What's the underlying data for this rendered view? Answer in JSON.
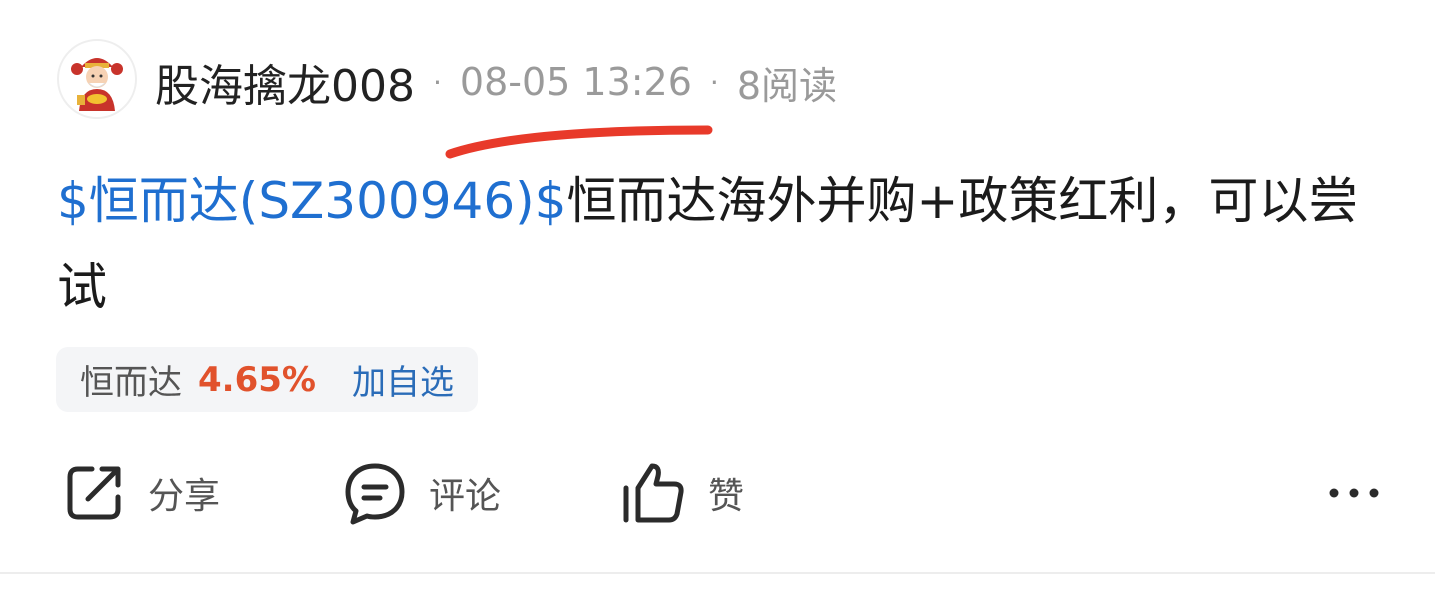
{
  "post": {
    "author": "股海擒龙008",
    "time": "08-05 13:26",
    "reads": "8阅读",
    "content": {
      "stock_link": "$恒而达(SZ300946)$",
      "text": "恒而达海外并购+政策红利，可以尝试"
    },
    "stock_tag": {
      "name": "恒而达",
      "change": "4.65%",
      "add_label": "加自选"
    },
    "actions": {
      "share": "分享",
      "comment": "评论",
      "like": "赞"
    }
  },
  "colors": {
    "link_blue": "#1f6fd0",
    "rise_red": "#e1522c",
    "annotation_red": "#e83a2a"
  },
  "icons": [
    "avatar",
    "share-icon",
    "comment-icon",
    "like-icon",
    "more-icon"
  ]
}
